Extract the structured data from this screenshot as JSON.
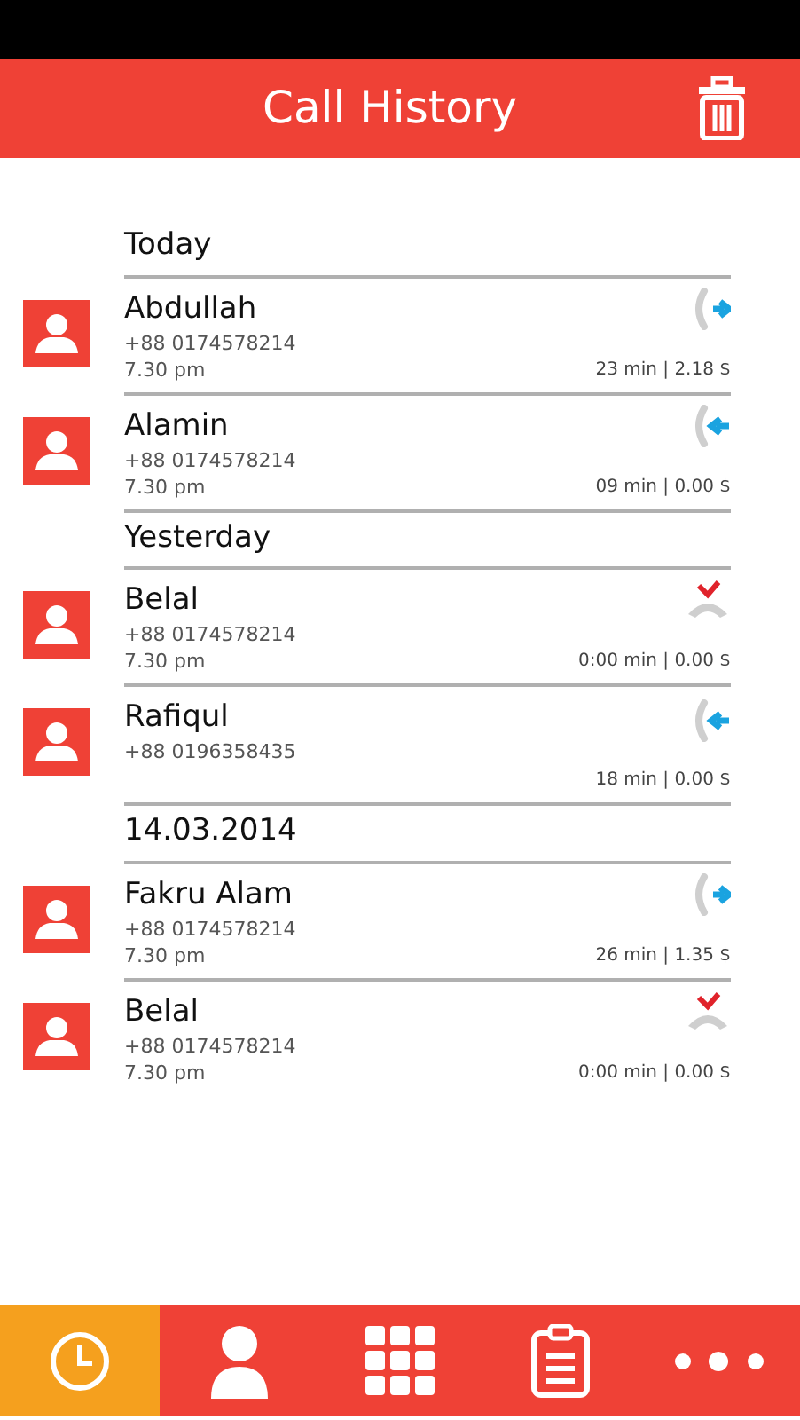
{
  "header": {
    "title": "Call History"
  },
  "groups": [
    {
      "label": "Today",
      "calls": [
        {
          "name": "Abdullah",
          "phone": "+88 0174578214",
          "time": "7.30 pm",
          "summary": "23 min | 2.18 $",
          "kind": "outgoing"
        },
        {
          "name": "Alamin",
          "phone": "+88 0174578214",
          "time": "7.30 pm",
          "summary": "09 min | 0.00 $",
          "kind": "incoming"
        }
      ]
    },
    {
      "label": "Yesterday",
      "calls": [
        {
          "name": "Belal",
          "phone": "+88 0174578214",
          "time": "7.30 pm",
          "summary": "0:00 min | 0.00 $",
          "kind": "missed"
        },
        {
          "name": "Rafiqul",
          "phone": "+88 0196358435",
          "summary": "18 min | 0.00 $",
          "kind": "incoming"
        }
      ]
    },
    {
      "label": "14.03.2014",
      "calls": [
        {
          "name": "Fakru Alam",
          "phone": "+88 0174578214",
          "time": "7.30 pm",
          "summary": "26 min | 1.35 $",
          "kind": "outgoing"
        },
        {
          "name": "Belal",
          "phone": "+88 0174578214",
          "time": "7.30 pm",
          "summary": "0:00 min | 0.00 $",
          "kind": "missed"
        }
      ]
    }
  ],
  "nav": [
    {
      "kind": "history",
      "selected": true
    },
    {
      "kind": "contacts",
      "selected": false
    },
    {
      "kind": "dialpad",
      "selected": false
    },
    {
      "kind": "notes",
      "selected": false
    },
    {
      "kind": "more",
      "selected": false
    }
  ]
}
